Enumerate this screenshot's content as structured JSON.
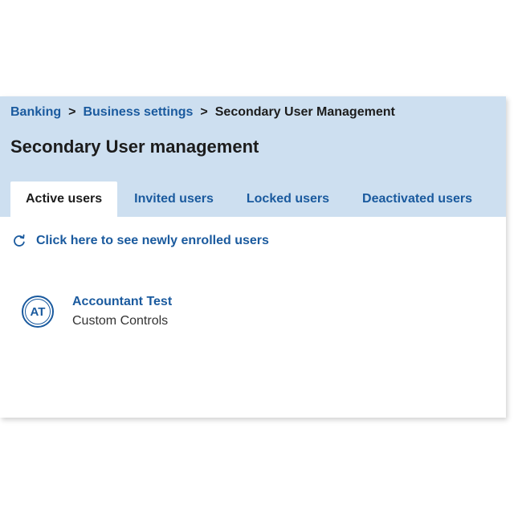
{
  "breadcrumb": {
    "items": [
      "Banking",
      "Business settings",
      "Secondary User Management"
    ],
    "separator": ">"
  },
  "page_title": "Secondary User management",
  "tabs": [
    {
      "label": "Active users",
      "active": true
    },
    {
      "label": "Invited users",
      "active": false
    },
    {
      "label": "Locked users",
      "active": false
    },
    {
      "label": "Deactivated users",
      "active": false
    }
  ],
  "refresh_link": {
    "label": "Click here to see newly enrolled users",
    "icon": "refresh-icon"
  },
  "users": [
    {
      "initials": "AT",
      "name": "Accountant Test",
      "role": "Custom Controls"
    }
  ],
  "colors": {
    "header_bg": "#cddff0",
    "link": "#1a5a9e",
    "text": "#1c1c1c"
  }
}
